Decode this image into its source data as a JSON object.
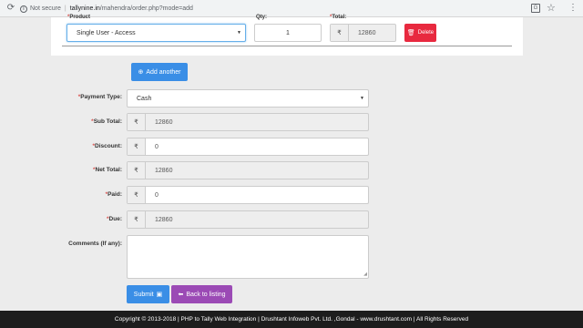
{
  "browser": {
    "security_text": "Not secure",
    "url_host": "tallynine.in",
    "url_path": "/mahendra/order.php?mode=add"
  },
  "product_row": {
    "product_label": "Product",
    "qty_label": "Qty:",
    "total_label": "Total:",
    "product_value": "Single User - Access",
    "qty_value": "1",
    "total_value": "12860",
    "delete_label": "Delete"
  },
  "buttons": {
    "add_another": "Add another",
    "submit": "Submit",
    "back": "Back to listing"
  },
  "currency_symbol": "₹",
  "form": {
    "payment_type_label": "Payment Type:",
    "payment_type_value": "Cash",
    "sub_total_label": "Sub Total:",
    "sub_total_value": "12860",
    "discount_label": "Discount:",
    "discount_value": "0",
    "net_total_label": "Net Total:",
    "net_total_value": "12860",
    "paid_label": "Paid:",
    "paid_value": "0",
    "due_label": "Due:",
    "due_value": "12860",
    "comments_label": "Comments (If any):",
    "comments_value": ""
  },
  "footer": {
    "text": "Copyright © 2013-2018 | PHP to Tally Web Integration | Drushtant Infoweb Pvt. Ltd. ,Gondal - www.drushtant.com | All Rights Reserved"
  }
}
